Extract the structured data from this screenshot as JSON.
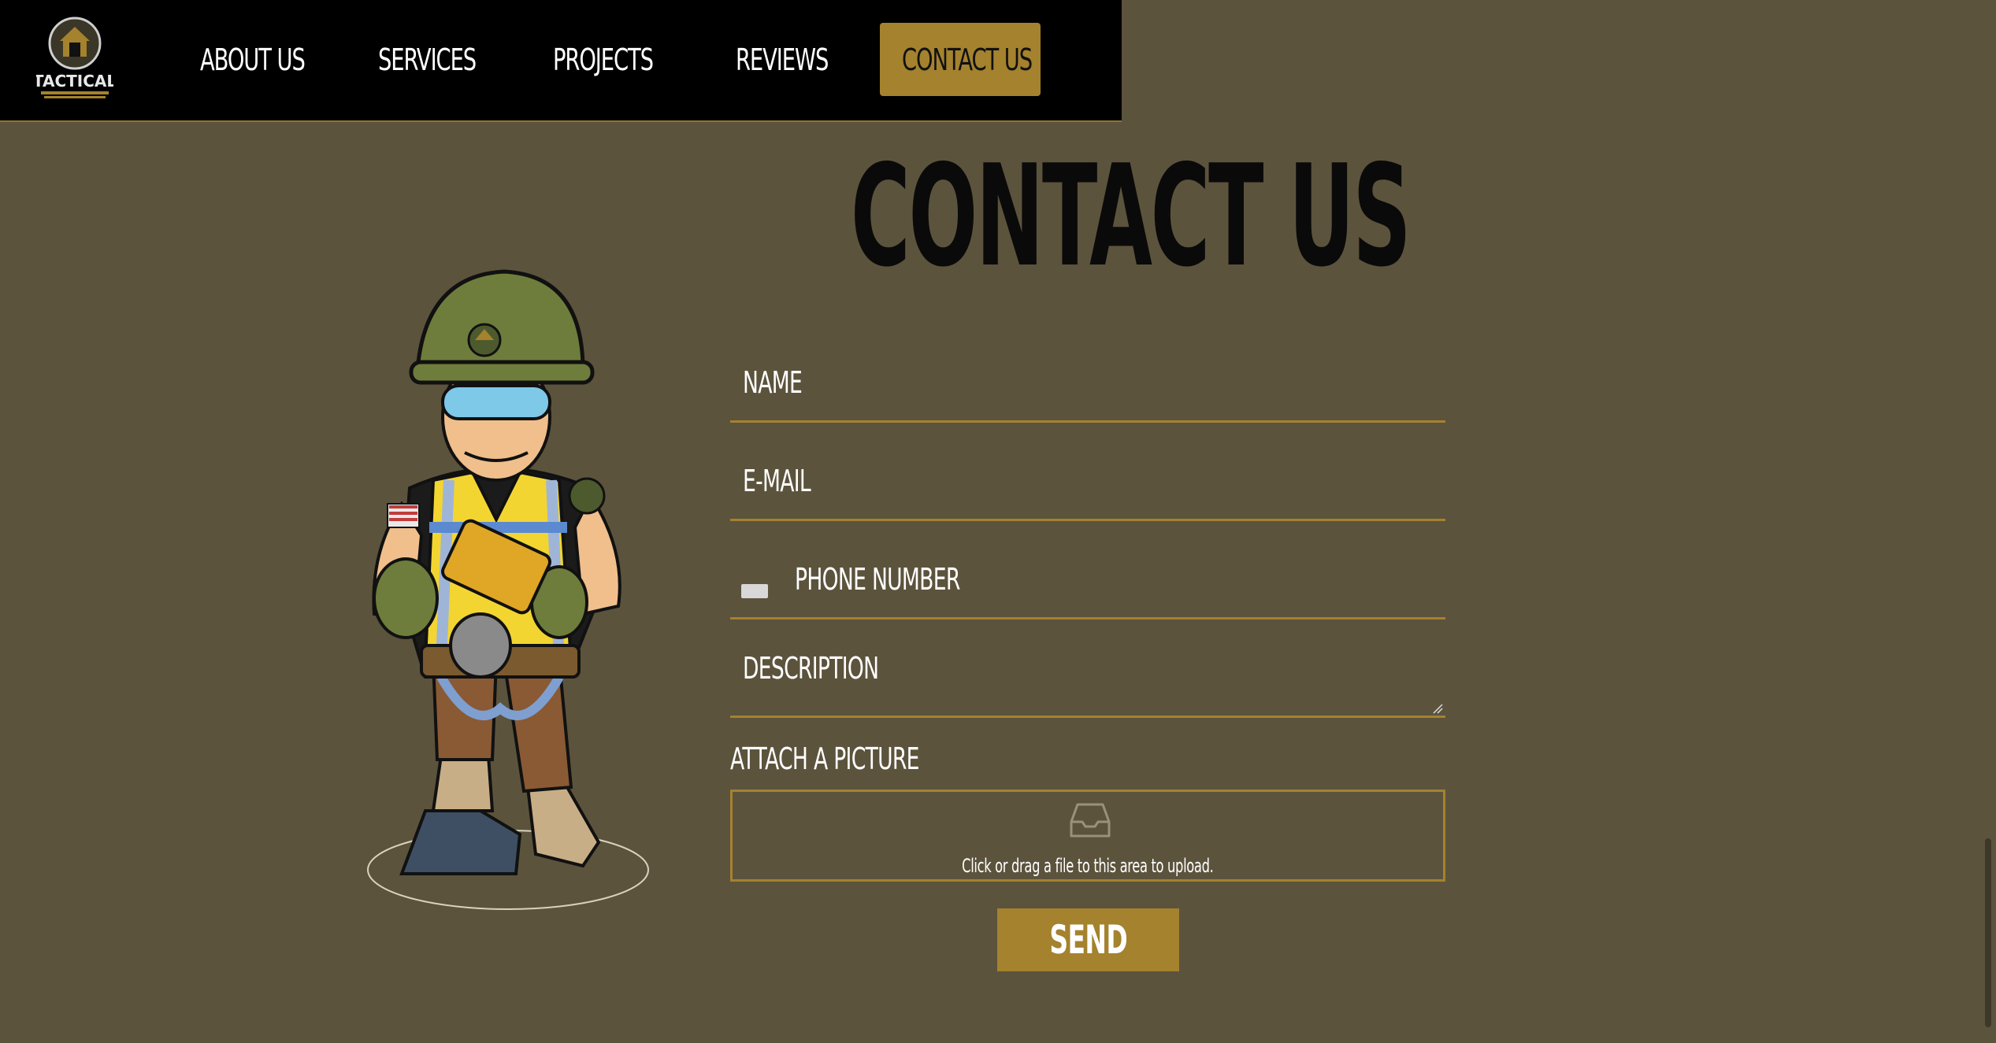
{
  "nav": {
    "logo_text": "TACTICAL",
    "links": [
      "ABOUT US",
      "SERVICES",
      "PROJECTS",
      "REVIEWS"
    ],
    "cta": "CONTACT US"
  },
  "page": {
    "heading": "CONTACT US"
  },
  "form": {
    "name_placeholder": "NAME",
    "email_placeholder": "E-MAIL",
    "phone_placeholder": "PHONE NUMBER",
    "description_placeholder": "DESCRIPTION",
    "attach_label": "ATTACH A PICTURE",
    "upload_hint": "Click or drag a file to this area to upload.",
    "submit_label": "SEND"
  },
  "colors": {
    "background": "#5c533d",
    "nav": "#000000",
    "accent": "#a4822e",
    "heading": "#0a0a0a",
    "text": "#ffffff"
  },
  "icons": [
    "logo-icon",
    "flag-icon",
    "upload-inbox-icon",
    "resize-grip-icon"
  ]
}
